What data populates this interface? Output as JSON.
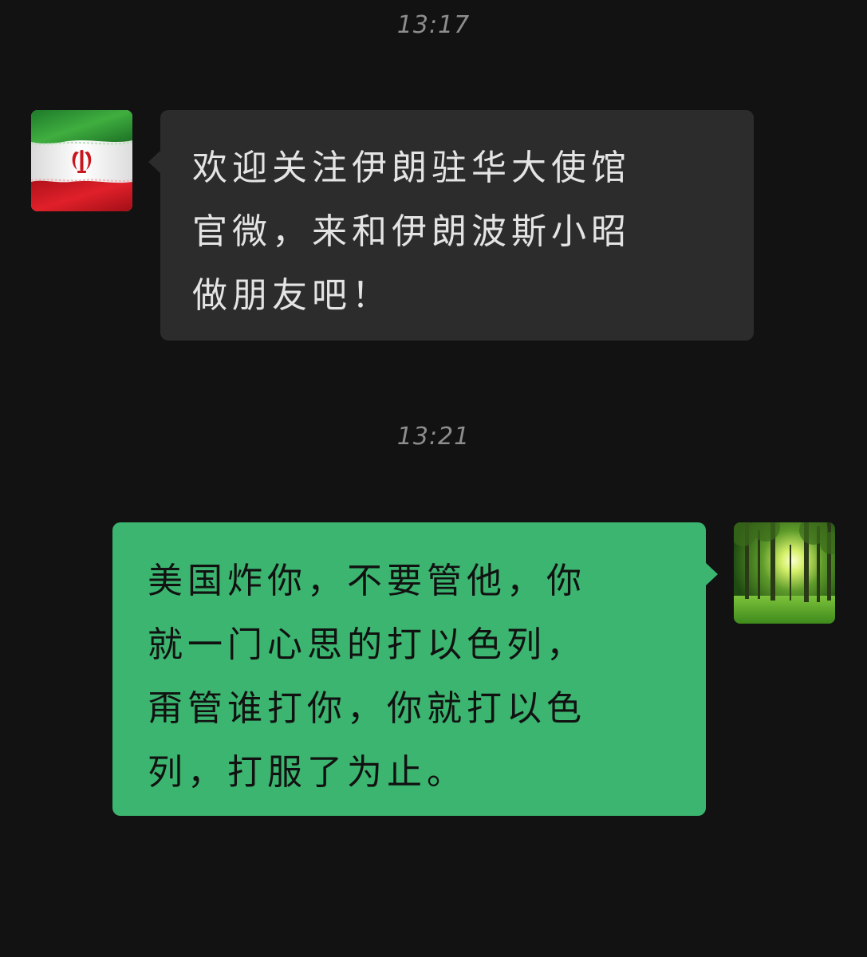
{
  "conversation": {
    "messages": [
      {
        "timestamp": "13:17",
        "direction": "incoming",
        "avatar": "iran-flag-avatar",
        "text": "欢迎关注伊朗驻华大使馆\n官微，来和伊朗波斯小昭\n做朋友吧！"
      },
      {
        "timestamp": "13:21",
        "direction": "outgoing",
        "avatar": "forest-avatar",
        "text": "美国炸你，不要管他，你\n就一门心思的打以色列，\n甭管谁打你，你就打以色\n列，打服了为止。"
      }
    ]
  },
  "colors": {
    "background": "#121212",
    "incoming_bubble": "#2c2c2c",
    "outgoing_bubble": "#3bb56f",
    "timestamp": "#8d8d8d"
  },
  "icons": {
    "incoming_avatar": "iran-flag-icon",
    "outgoing_avatar": "forest-sunlight-icon"
  }
}
